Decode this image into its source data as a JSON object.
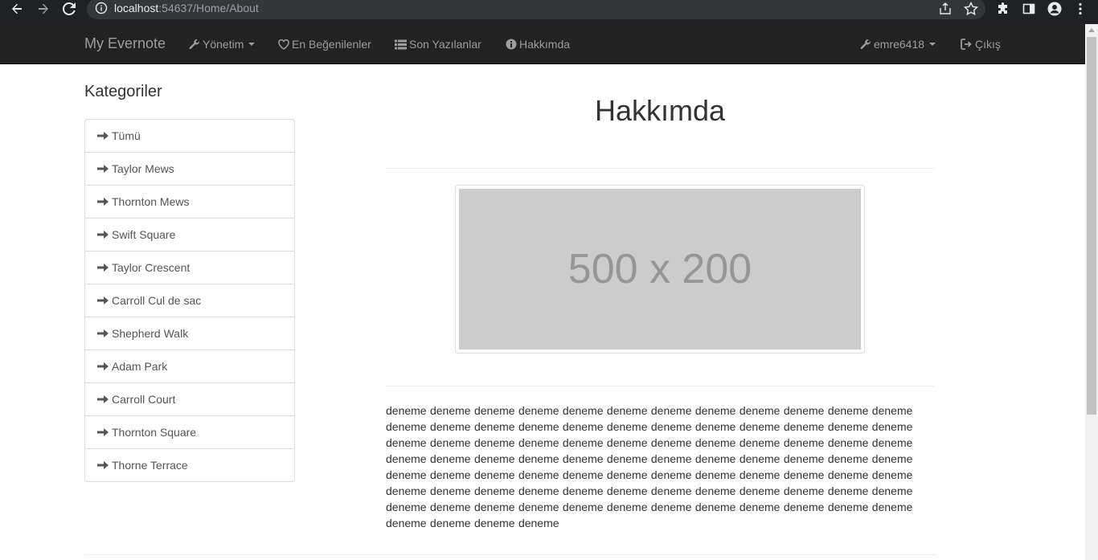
{
  "browser": {
    "url_host": "localhost",
    "url_rest": ":54637/Home/About"
  },
  "navbar": {
    "brand": "My Evernote",
    "items": [
      {
        "label": "Yönetim",
        "icon": "wrench-icon"
      },
      {
        "label": "En Beğenilenler",
        "icon": "heart-icon"
      },
      {
        "label": "Son Yazılanlar",
        "icon": "list-icon"
      },
      {
        "label": "Hakkımda",
        "icon": "info-icon"
      }
    ],
    "user": {
      "label": "emre6418",
      "icon": "wrench-icon"
    },
    "logout": {
      "label": "Çıkış",
      "icon": "logout-icon"
    }
  },
  "sidebar": {
    "title": "Kategoriler",
    "items": [
      {
        "label": "Tümü"
      },
      {
        "label": "Taylor Mews"
      },
      {
        "label": "Thornton Mews"
      },
      {
        "label": "Swift Square"
      },
      {
        "label": "Taylor Crescent"
      },
      {
        "label": "Carroll Cul de sac"
      },
      {
        "label": "Shepherd Walk"
      },
      {
        "label": "Adam Park"
      },
      {
        "label": "Carroll Court"
      },
      {
        "label": "Thornton Square"
      },
      {
        "label": "Thorne Terrace"
      }
    ]
  },
  "main": {
    "title": "Hakkımda",
    "image_placeholder": "500 x 200",
    "lines": [
      "deneme deneme deneme deneme deneme deneme deneme deneme deneme deneme deneme deneme",
      "deneme deneme deneme deneme deneme deneme deneme deneme deneme deneme deneme deneme",
      "deneme deneme deneme deneme deneme deneme deneme deneme deneme deneme deneme deneme",
      "deneme deneme deneme deneme deneme deneme deneme deneme deneme deneme deneme deneme",
      "deneme deneme deneme deneme deneme deneme deneme deneme deneme deneme deneme deneme",
      "deneme deneme deneme deneme deneme deneme deneme deneme deneme deneme deneme deneme",
      "deneme deneme deneme deneme deneme deneme deneme deneme deneme deneme deneme deneme",
      "deneme deneme deneme deneme"
    ]
  },
  "colors": {
    "navbar_bg": "#222222",
    "navbar_text": "#9d9d9d",
    "placeholder_bg": "#cccccc",
    "placeholder_text": "#969696"
  }
}
